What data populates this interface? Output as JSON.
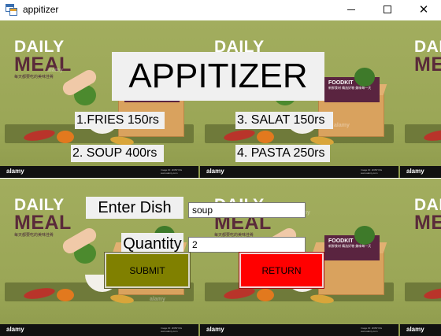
{
  "window": {
    "title": "appitizer",
    "minimize_glyph": "",
    "maximize_glyph": "",
    "close_glyph": "✕"
  },
  "background": {
    "tile_title_line1": "DAILY",
    "tile_title_line2": "MEAL",
    "tile_caption": "每天都要吃的美味佳肴",
    "foodkit_title": "FOODKIT",
    "foodkit_caption": "新鲜食材 精选好物 美味每一天",
    "watermark": "alamy",
    "stock_id": "Image ID: 2F8NY9G www.alamy.com",
    "colors": {
      "green": "#9da85a",
      "plum": "#5a2440",
      "footer": "#111111"
    }
  },
  "heading": "APPITIZER",
  "menu": {
    "fries": "1.FRIES 150rs",
    "salat": "3. SALAT  150rs",
    "soup": "2. SOUP  400rs",
    "pasta": "4. PASTA 250rs"
  },
  "form": {
    "dish_label": "Enter Dish",
    "dish_value": "soup",
    "quantity_label": "Quantity",
    "quantity_value": "2",
    "submit_label": "SUBMIT",
    "return_label": "RETURN",
    "colors": {
      "submit": "#808000",
      "return": "#ff0000",
      "label_bg": "#f0f0f0"
    }
  }
}
